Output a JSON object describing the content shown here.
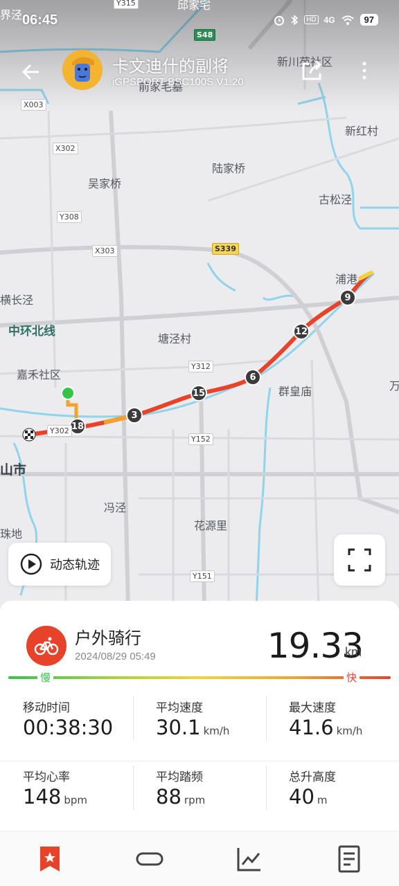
{
  "status_bar": {
    "time": "06:45",
    "network": "4G",
    "hd": "HD",
    "battery": "97"
  },
  "header": {
    "title": "卡文迪什的副将",
    "subtitle": "iGPSPORT BSC100S  V1.20"
  },
  "map": {
    "place_labels": [
      "前家毛墓",
      "新川苑社区",
      "新红村",
      "吴家桥",
      "陆家桥",
      "古松泾",
      "浦港",
      "中环北线",
      "塘泾村",
      "嘉禾社区",
      "群皇庙",
      "横长泾",
      "冯泾",
      "花源里",
      "山市",
      "珠地",
      "万",
      "界泾",
      "邱家宅"
    ],
    "road_labels": [
      "X003",
      "X302",
      "Y308",
      "X303",
      "S339",
      "Y312",
      "Y152",
      "Y151",
      "S48",
      "Y315",
      "Y302"
    ],
    "km_markers": [
      "18",
      "3",
      "15",
      "6",
      "12",
      "9"
    ],
    "track_playback_label": "动态轨迹"
  },
  "activity": {
    "name": "户外骑行",
    "datetime": "2024/08/29 05:49",
    "distance": "19.33",
    "distance_unit": "km",
    "scale_slow": "慢",
    "scale_fast": "快"
  },
  "stats": [
    [
      {
        "label": "移动时间",
        "value": "00:38:30",
        "unit": ""
      },
      {
        "label": "平均速度",
        "value": "30.1",
        "unit": "km/h"
      },
      {
        "label": "最大速度",
        "value": "41.6",
        "unit": "km/h"
      }
    ],
    [
      {
        "label": "平均心率",
        "value": "148",
        "unit": "bpm"
      },
      {
        "label": "平均踏频",
        "value": "88",
        "unit": "rpm"
      },
      {
        "label": "总升高度",
        "value": "40",
        "unit": "m"
      }
    ]
  ],
  "colors": {
    "accent": "#e6432a",
    "slow": "#35c44a",
    "track_start": "#f3d23a",
    "water": "#8fd3ec"
  },
  "icons": {
    "back": "back-arrow-icon",
    "share": "share-icon",
    "more": "more-vertical-icon",
    "play": "play-icon",
    "fullscreen": "fullscreen-icon",
    "bike": "bicycle-icon",
    "nav": [
      "bookmark-star-icon",
      "loop-icon",
      "chart-icon",
      "document-icon"
    ]
  }
}
